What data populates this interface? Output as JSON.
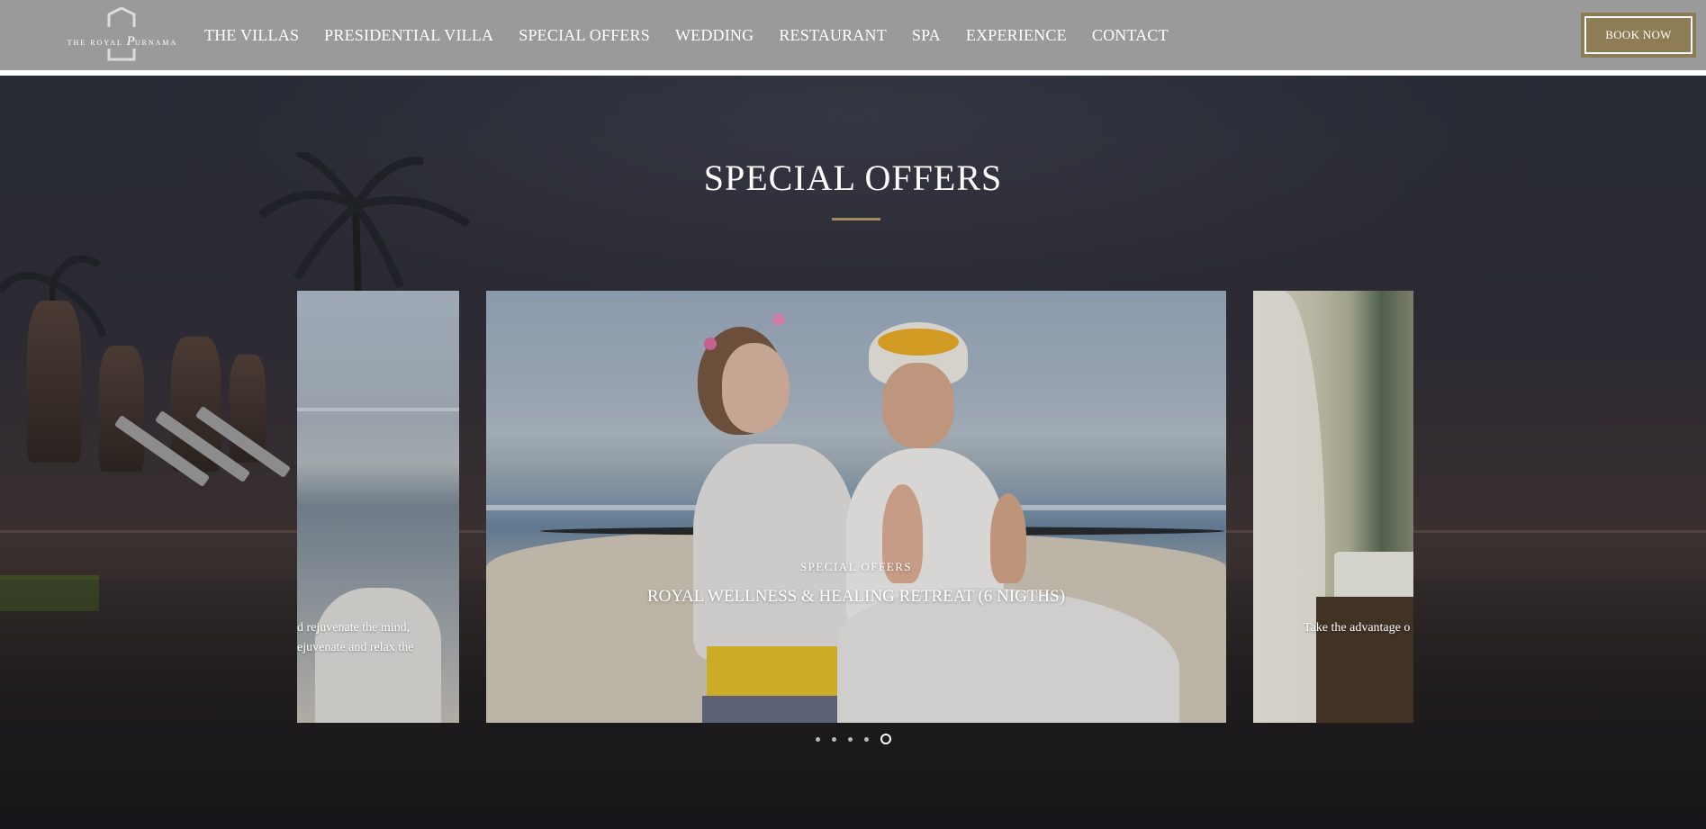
{
  "header": {
    "logo": {
      "prefix": "THE ROYAL",
      "script": "P",
      "suffix": "URNAMA"
    },
    "nav": [
      "THE VILLAS",
      "PRESIDENTIAL VILLA",
      "SPECIAL OFFERS",
      "WEDDING",
      "RESTAURANT",
      "SPA",
      "EXPERIENCE",
      "CONTACT"
    ],
    "book_button": "BOOK NOW"
  },
  "section": {
    "title": "SPECIAL OFFERS"
  },
  "carousel": {
    "left_slide": {
      "line1": "d rejuvenate the mind,",
      "line2": "ejuvenate and relax the"
    },
    "center_slide": {
      "kicker": "SPECIAL OFFERS",
      "title": "ROYAL WELLNESS & HEALING RETREAT (6 NIGTHS)"
    },
    "right_slide": {
      "line1": "Take the advantage o"
    },
    "page_count": 5,
    "active_index": 4
  },
  "colors": {
    "header_bg": "#9a9a9a",
    "accent_gold": "#8e7c55",
    "rule_gold": "#a08c5f"
  }
}
